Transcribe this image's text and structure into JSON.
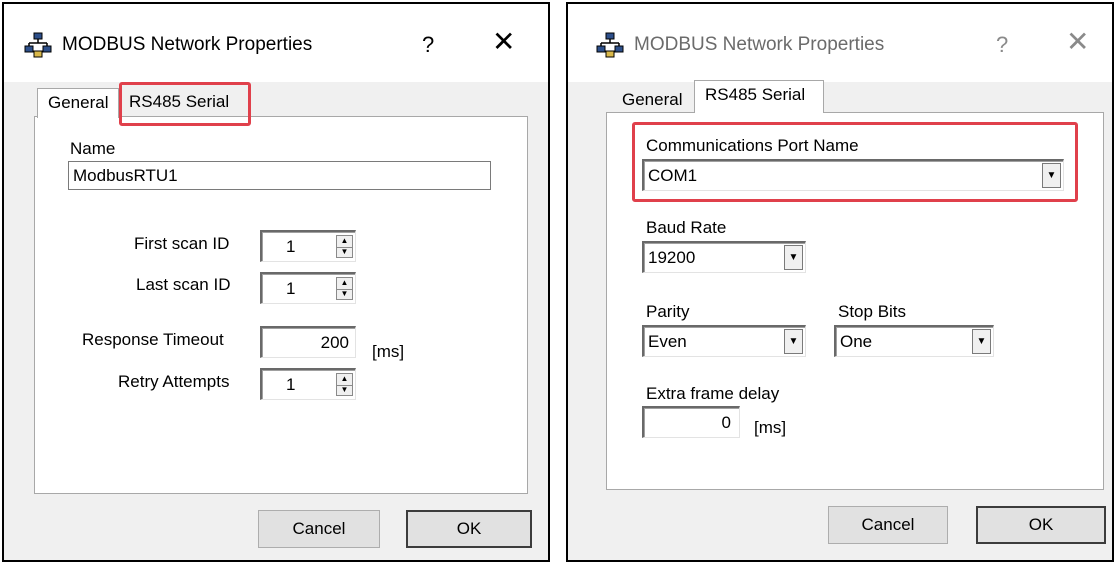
{
  "left_dialog": {
    "title": "MODBUS Network Properties",
    "help_glyph": "?",
    "close_glyph": "✕",
    "tabs": [
      {
        "label": "General"
      },
      {
        "label": "RS485 Serial"
      }
    ],
    "active_tab": "General",
    "highlighted_tab": "RS485 Serial",
    "name_label": "Name",
    "name_value": "ModbusRTU1",
    "first_scan_label": "First scan ID",
    "first_scan_value": "1",
    "last_scan_label": "Last scan ID",
    "last_scan_value": "1",
    "response_timeout_label": "Response Timeout",
    "response_timeout_value": "200",
    "response_timeout_unit": "[ms]",
    "retry_label": "Retry Attempts",
    "retry_value": "1",
    "cancel_label": "Cancel",
    "ok_label": "OK"
  },
  "right_dialog": {
    "title": "MODBUS Network Properties",
    "help_glyph": "?",
    "close_glyph": "✕",
    "tabs": [
      {
        "label": "General"
      },
      {
        "label": "RS485 Serial"
      }
    ],
    "active_tab": "RS485 Serial",
    "comm_port_label": "Communications Port Name",
    "comm_port_value": "COM1",
    "baud_label": "Baud Rate",
    "baud_value": "19200",
    "parity_label": "Parity",
    "parity_value": "Even",
    "stop_bits_label": "Stop Bits",
    "stop_bits_value": "One",
    "extra_delay_label": "Extra frame delay",
    "extra_delay_value": "0",
    "extra_delay_unit": "[ms]",
    "cancel_label": "Cancel",
    "ok_label": "OK"
  },
  "icons": {
    "app_icon": "network-tree-icon",
    "spin_icon": "spin-up-down-icon",
    "dropdown_icon": "dropdown-arrow-icon"
  },
  "colors": {
    "highlight": "#e0404b",
    "dialog_bg": "#f0f0f0",
    "panel_bg": "#ffffff"
  }
}
